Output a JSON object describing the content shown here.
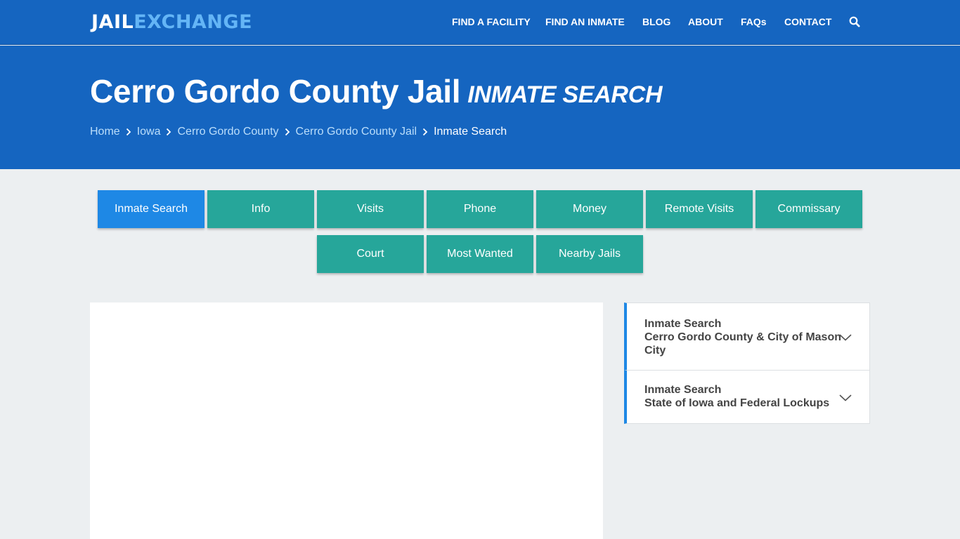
{
  "header": {
    "logo_part1": "JAIL",
    "logo_part2": "EXCHANGE",
    "nav": [
      "FIND A FACILITY",
      "FIND AN INMATE",
      "BLOG",
      "ABOUT",
      "FAQs",
      "CONTACT"
    ]
  },
  "hero": {
    "title": "Cerro Gordo County Jail",
    "subtitle": "INMATE SEARCH",
    "breadcrumbs": [
      "Home",
      "Iowa",
      "Cerro Gordo County",
      "Cerro Gordo County Jail",
      "Inmate Search"
    ]
  },
  "tabs": {
    "row1": [
      "Inmate Search",
      "Info",
      "Visits",
      "Phone",
      "Money",
      "Remote Visits",
      "Commissary"
    ],
    "row2": [
      "Court",
      "Most Wanted",
      "Nearby Jails"
    ],
    "active": "Inmate Search"
  },
  "sidebar": {
    "accordions": [
      {
        "line1": "Inmate Search",
        "line2": "Cerro Gordo County & City of Mason",
        "line3": "City"
      },
      {
        "line1": "Inmate Search",
        "line2": "State of Iowa and Federal Lockups"
      }
    ]
  },
  "colors": {
    "primary": "#1565c0",
    "accent_light": "#64b5f6",
    "tab": "#26a69a",
    "tab_active": "#1e88e5",
    "background": "#eceff1"
  },
  "icons": {
    "search": "search-icon",
    "breadcrumb_separator": "chevron-right-icon",
    "accordion_toggle": "chevron-down-icon"
  }
}
